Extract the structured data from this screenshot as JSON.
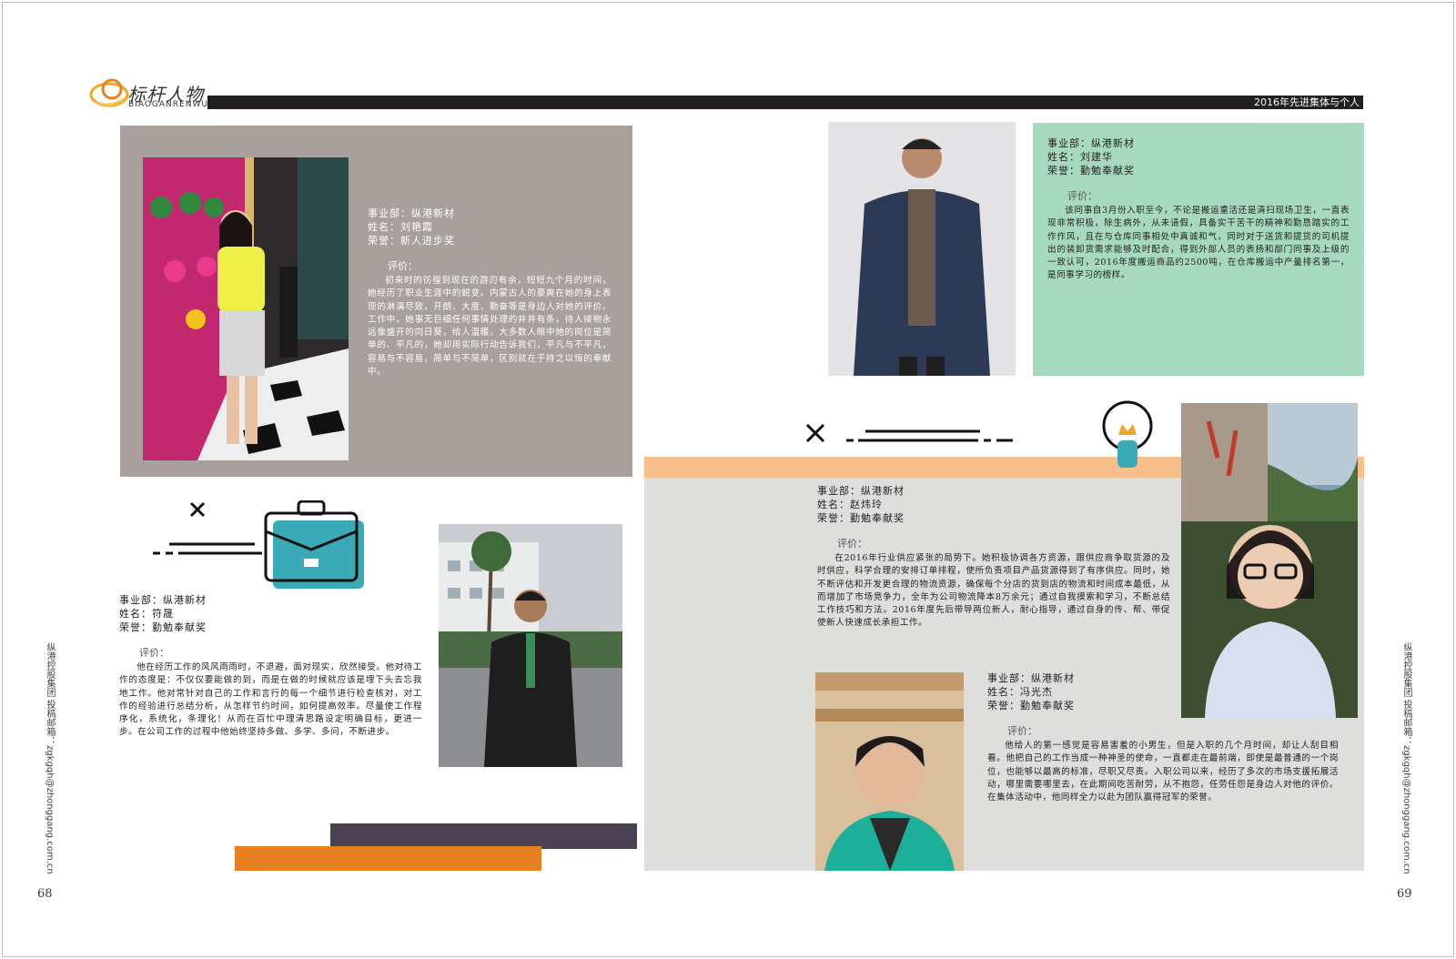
{
  "header": {
    "logo_cn": "标杆人物",
    "logo_en": "BIAOGANRENWU",
    "title": "2016年先进集体与个人"
  },
  "profiles": [
    {
      "department": "事业部：纵港新材",
      "name": "姓名：刘艳霞",
      "honor": "荣誉：新人进步奖",
      "eval_label": "评价：",
      "eval_body": "初来时的彷徨到现在的游刃有余，短短九个月的时间，她经历了职业生涯中的蜕变。内蒙古人的豪爽在她的身上表现的淋漓尽致，开朗、大度、勤奋等是身边人对她的评价。工作中，她事无巨细任何事情处理的井井有条，待人接物永远像盛开的向日葵，给人温暖。大多数人眼中她的岗位是简单的、平凡的，她却用实际行动告诉我们，平凡与不平凡，容易与不容易，简单与不简单，区别就在于持之以恒的奉献中。"
    },
    {
      "department": "事业部：纵港新材",
      "name": "姓名：刘建华",
      "honor": "荣誉：勤勉奉献奖",
      "eval_label": "评价：",
      "eval_body": "该同事自3月份入职至今，不论是搬运重活还是清扫现场卫生，一直表现非常积极，除生病外，从未请假，具备实干苦干的精神和勤恳踏实的工作作风，且在与仓库同事相处中真诚和气，同时对于送货和提货的司机提出的装卸货需求能够及时配合，得到外部人员的表扬和部门同事及上级的一致认可，2016年度搬运商品约2500吨，在仓库搬运中产量排名第一，是同事学习的榜样。"
    },
    {
      "department": "事业部：纵港新材",
      "name": "姓名：符晟",
      "honor": "荣誉：勤勉奉献奖",
      "eval_label": "评价：",
      "eval_body": "他在经历工作的风风雨雨时，不退避，面对现实，欣然接受。他对待工作的态度是：不仅仅要能做的到，而是在做的时候就应该是埋下头去忘我地工作。他对常针对自己的工作和言行的每一个细节进行检查核对，对工作的经验进行总结分析，从怎样节约时间，如何提高效率。尽量使工作程序化，系统化，条理化！从而在百忙中理清思路设定明确目标，更进一步。在公司工作的过程中他始终坚持多做、多学、多问，不断进步。"
    },
    {
      "department": "事业部：纵港新材",
      "name": "姓名：赵炜玲",
      "honor": "荣誉：勤勉奉献奖",
      "eval_label": "评价：",
      "eval_body": "在2016年行业供应紧张的局势下。她积极协调各方资源，跟供应商争取货源的及时供应，科学合理的安排订单排程，使所负责项目产品货源得到了有序供应。同时，她不断评估和开发更合理的物流资源，确保每个分店的货到店的物流和时间成本最低，从而增加了市场竞争力，全年为公司物流降本8万余元；通过自我摸索和学习，不断总结工作技巧和方法。2016年度先后带导两位新人，耐心指导，通过自身的传、帮、带促使新人快速成长承担工作。"
    },
    {
      "department": "事业部：纵港新材",
      "name": "姓名：冯光杰",
      "honor": "荣誉：勤勉奉献奖",
      "eval_label": "评价：",
      "eval_body": "他给人的第一感觉是容易害羞的小男生，但是入职的几个月时间，却让人刮目相看。他把自己的工作当成一种神圣的使命，一直都走在最前端，即使是最普通的一个岗位，也能够以最高的标准，尽职又尽责。入职公司以来，经历了多次的市场支援拓展活动，哪里需要哪里去，在此期间吃苦耐劳，从不抱怨，任劳任怨是身边人对他的评价。在集体活动中，他同样全力以赴为团队赢得冠军的荣誉。"
    }
  ],
  "sidebar": {
    "left": "纵港控股集团 投稿邮箱：zgkgqh@zhonggang.com.cn",
    "right": "纵港控股集团 投稿邮箱：zgkgqh@zhonggang.com.cn"
  },
  "pages": {
    "left": "68",
    "right": "69"
  },
  "colors": {
    "gray_panel": "#a7a09d",
    "green_panel": "#a6d9c0",
    "light_panel": "#dededc",
    "orange_stripe": "#f8bf8b",
    "teal": "#3aaab6",
    "orange": "#e57f21",
    "dark_bar": "#4a4253"
  }
}
